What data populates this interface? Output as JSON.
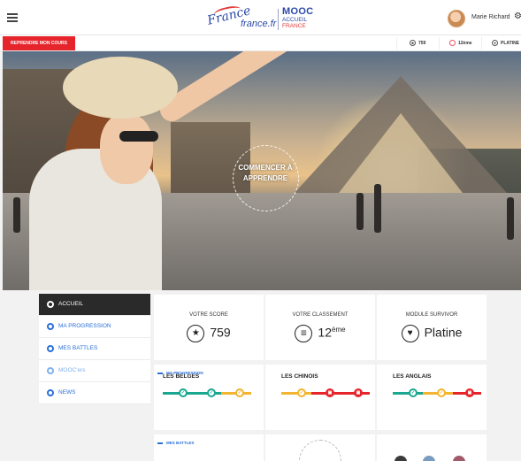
{
  "header": {
    "menu_icon": "hamburger-icon",
    "logo": {
      "script": "France",
      "site": "france.fr",
      "mooc": "MOOC",
      "accueil": "ACCUEIL",
      "country": "FRANCE"
    },
    "user_name": "Marie Richard",
    "settings_icon": "gear-icon"
  },
  "subbar": {
    "resume_label": "REPRENDRE MON COURS",
    "stats": [
      {
        "icon": "star-icon",
        "value": "759"
      },
      {
        "icon": "rank-icon",
        "value": "12ème"
      },
      {
        "icon": "heart-icon",
        "value": "PLATINE"
      }
    ]
  },
  "hero": {
    "cta_line1": "COMMENCER À",
    "cta_line2": "APPRENDRE"
  },
  "sidebar": {
    "items": [
      {
        "label": "ACCUEIL"
      },
      {
        "label": "MA PROGRESSION"
      },
      {
        "label": "MES BATTLES"
      },
      {
        "label": "MOOC'ers"
      },
      {
        "label": "NEWS"
      }
    ]
  },
  "progress": {
    "section_title": "MA PROGRESSION",
    "score_caption": "VOTRE SCORE",
    "score_value": "759",
    "rank_caption": "VOTRE CLASSEMENT",
    "rank_value": "12",
    "rank_suffix": "ème",
    "survivor_caption": "MODULE SURVIVOR",
    "survivor_value": "Platine"
  },
  "teams": {
    "section_title": "MA PROGRESSION",
    "items": [
      {
        "name": "LES BELGES",
        "nodes": [
          "ok",
          "ok",
          "pend"
        ]
      },
      {
        "name": "LES CHINOIS",
        "nodes": [
          "pend",
          "lock",
          "lock"
        ]
      },
      {
        "name": "LES ANGLAIS",
        "nodes": [
          "ok",
          "pend",
          "lock"
        ]
      }
    ]
  },
  "battles": {
    "section_title": "MES BATTLES"
  },
  "colors": {
    "accent": "#2a6fdb",
    "red": "#e5242b",
    "green": "#1aa78f",
    "yellow": "#f2b431"
  }
}
